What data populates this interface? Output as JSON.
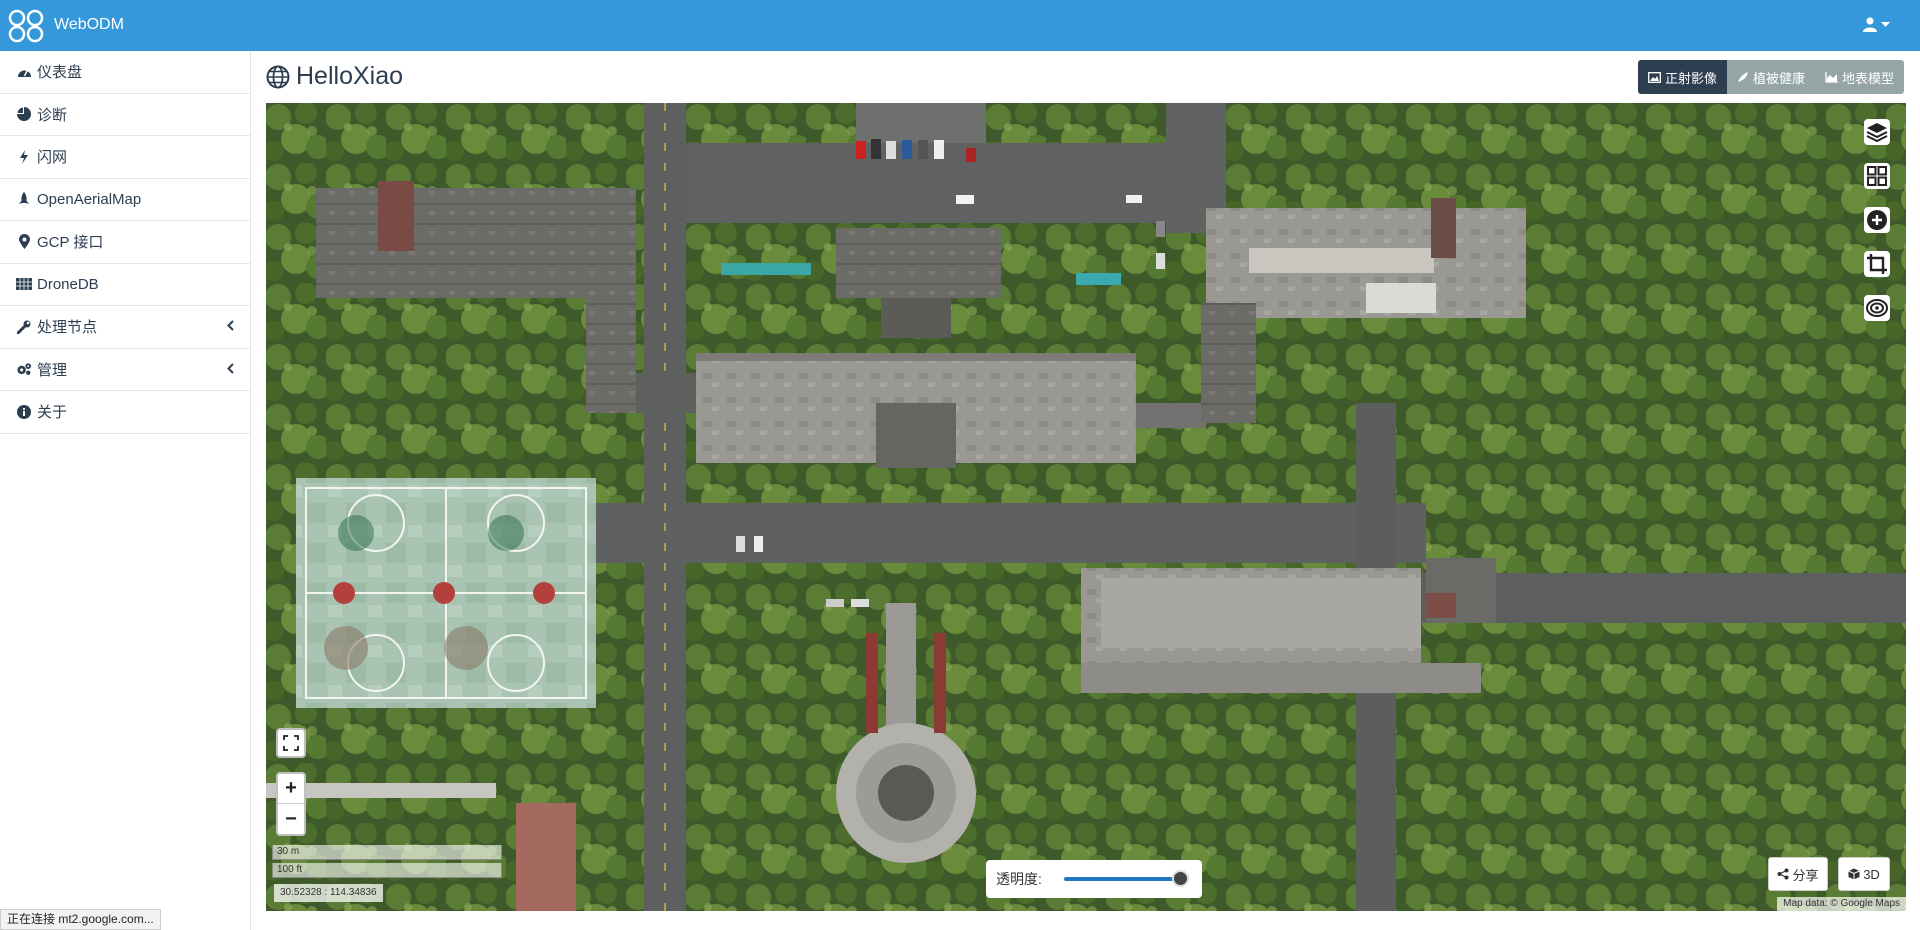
{
  "app": {
    "brand": "WebODM",
    "user_icon": "user-icon"
  },
  "sidebar": {
    "items": [
      {
        "label": "仪表盘",
        "icon": "dashboard-icon"
      },
      {
        "label": "诊断",
        "icon": "pie-chart-icon"
      },
      {
        "label": "闪网",
        "icon": "bolt-icon"
      },
      {
        "label": "OpenAerialMap",
        "icon": "rocket-icon"
      },
      {
        "label": "GCP 接口",
        "icon": "map-marker-icon"
      },
      {
        "label": "DroneDB",
        "icon": "database-icon"
      },
      {
        "label": "处理节点",
        "icon": "wrench-icon",
        "expandable": true
      },
      {
        "label": "管理",
        "icon": "cogs-icon",
        "expandable": true
      },
      {
        "label": "关于",
        "icon": "info-circle-icon"
      }
    ]
  },
  "page": {
    "title": "HelloXiao",
    "title_icon": "globe-icon"
  },
  "view_switch": {
    "buttons": [
      {
        "label": "正射影像",
        "icon": "image-icon",
        "active": true
      },
      {
        "label": "植被健康",
        "icon": "plant-icon",
        "active": false
      },
      {
        "label": "地表模型",
        "icon": "area-chart-icon",
        "active": false
      }
    ]
  },
  "map": {
    "controls_right": [
      "layers-icon",
      "grid-icon",
      "plus-circle-icon",
      "crop-icon",
      "eye-icon"
    ],
    "fullscreen_icon": "expand-icon",
    "zoom_in": "+",
    "zoom_out": "−",
    "scale_metric": "30 m",
    "scale_imperial": "100 ft",
    "coordinates": "30.52328 : 114.34836",
    "opacity_label": "透明度:",
    "opacity_value": 0.95,
    "share_label": "分享",
    "threed_label": "3D",
    "attribution": "Map data: © Google Maps"
  },
  "status_bar": "正在连接 mt2.google.com..."
}
